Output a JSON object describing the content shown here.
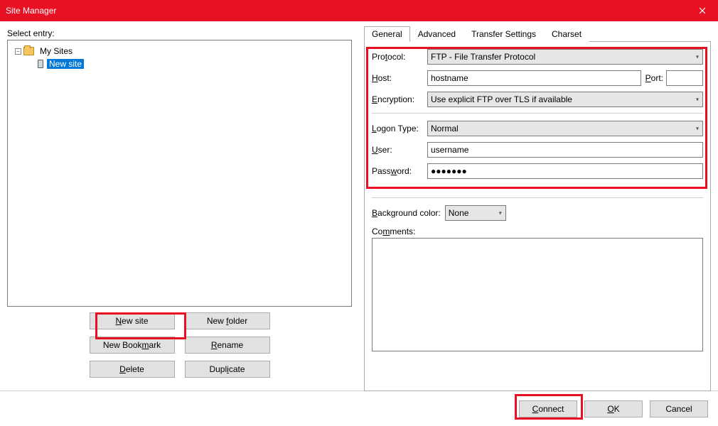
{
  "window": {
    "title": "Site Manager"
  },
  "left": {
    "select_entry_label": "Select entry:",
    "tree": {
      "root": "My Sites",
      "item1": "New site"
    },
    "buttons": {
      "new_site": "New site",
      "new_folder": "New folder",
      "new_bookmark": "New Bookmark",
      "rename": "Rename",
      "delete": "Delete",
      "duplicate": "Duplicate"
    }
  },
  "tabs": {
    "general": "General",
    "advanced": "Advanced",
    "transfer": "Transfer Settings",
    "charset": "Charset"
  },
  "form": {
    "protocol_label": "Protocol:",
    "protocol_value": "FTP - File Transfer Protocol",
    "host_label": "Host:",
    "host_value": "hostname",
    "port_label": "Port:",
    "port_value": "",
    "encryption_label": "Encryption:",
    "encryption_value": "Use explicit FTP over TLS if available",
    "logon_label": "Logon Type:",
    "logon_value": "Normal",
    "user_label": "User:",
    "user_value": "username",
    "password_label": "Password:",
    "password_value": "●●●●●●●",
    "bg_label": "Background color:",
    "bg_value": "None",
    "comments_label": "Comments:",
    "comments_value": ""
  },
  "footer": {
    "connect": "Connect",
    "ok": "OK",
    "cancel": "Cancel"
  }
}
